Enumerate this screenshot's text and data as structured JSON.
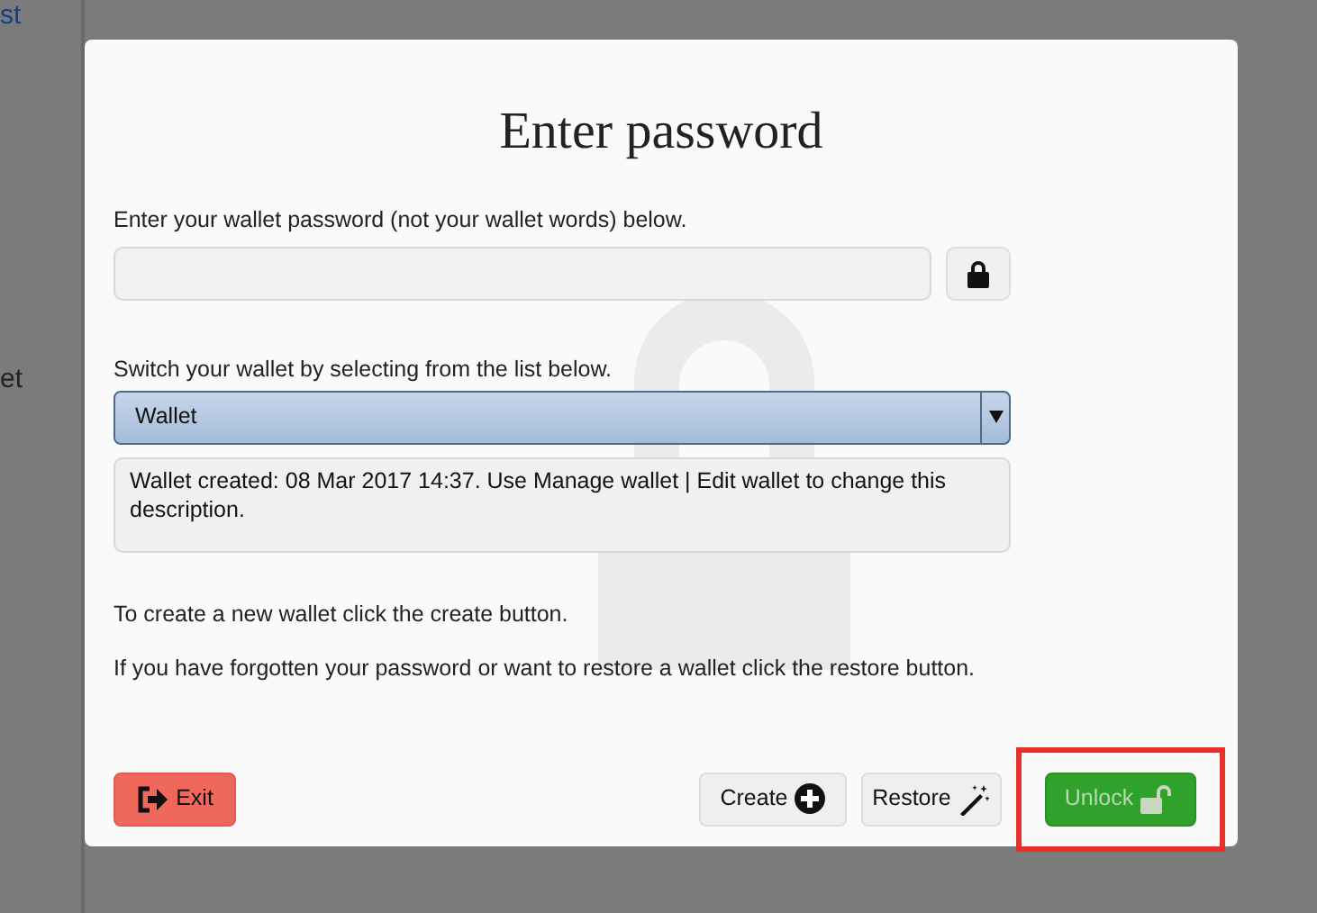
{
  "background": {
    "fragments": [
      {
        "text": "st",
        "kind": "link"
      },
      {
        "text": "et",
        "kind": "plain"
      }
    ]
  },
  "dialog": {
    "title": "Enter password",
    "password_label": "Enter your wallet password (not your wallet words) below.",
    "wallet_label": "Switch your wallet by selecting from the list below.",
    "wallet_select": {
      "value": "Wallet"
    },
    "description": "Wallet created: 08 Mar 2017 14:37. Use Manage wallet | Edit wallet to change this description.",
    "notes": [
      "To create a new wallet click the create button.",
      "If you have forgotten your password or want to restore a wallet click the restore button."
    ],
    "buttons": [
      {
        "label": "Exit",
        "kind": "exit",
        "disabled": false,
        "highlighted": false
      },
      {
        "label": "Create",
        "kind": "create",
        "disabled": false,
        "highlighted": false
      },
      {
        "label": "Restore",
        "kind": "restore",
        "disabled": false,
        "highlighted": false
      },
      {
        "label": "Unlock",
        "kind": "unlock",
        "disabled": true,
        "highlighted": true
      }
    ]
  }
}
